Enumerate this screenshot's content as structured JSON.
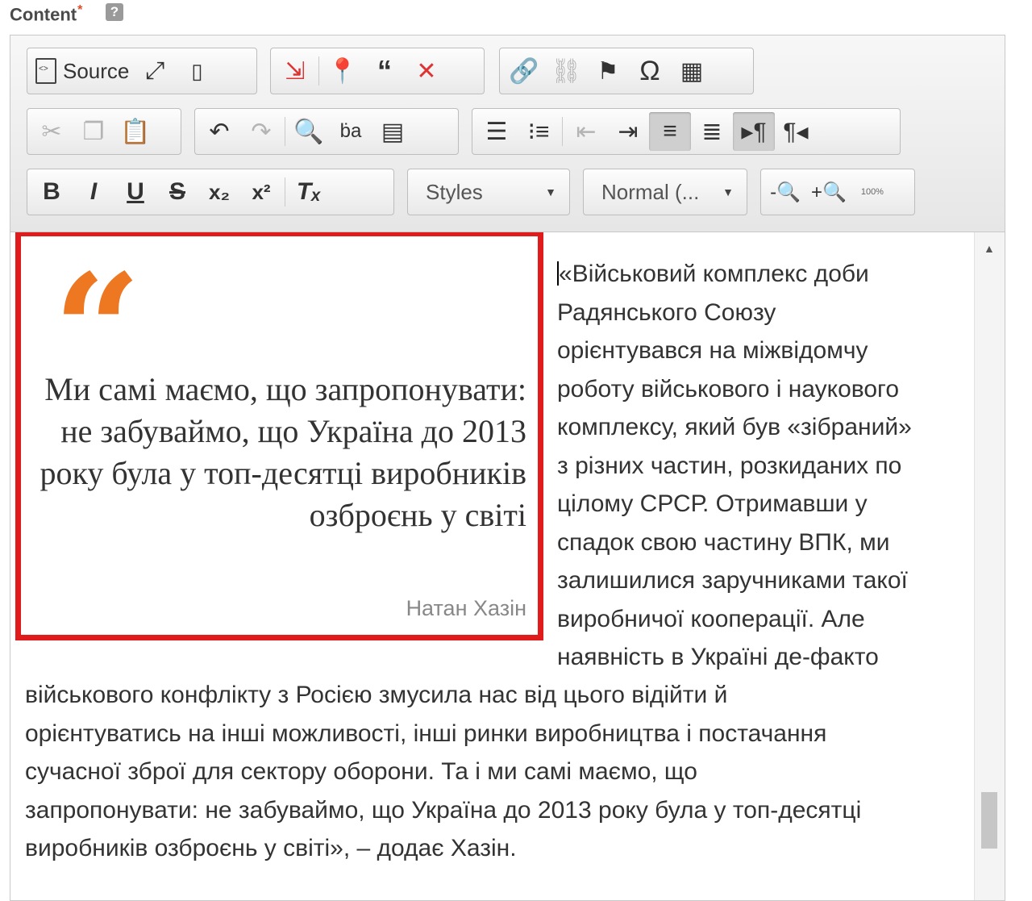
{
  "field": {
    "label": "Content",
    "required_mark": "*",
    "help": "?"
  },
  "toolbar": {
    "source_label": "Source",
    "styles_value": "Styles",
    "format_value": "Normal (...",
    "zoom_label": "100%",
    "icons": {
      "bold": "B",
      "italic": "I",
      "underline": "U",
      "strike": "S",
      "subscript": "x₂",
      "superscript": "x²",
      "remove_format": "Tₓ"
    }
  },
  "content": {
    "quote": {
      "text": "Ми самі маємо, що запропонувати: не забуваймо, що Україна до 2013 року була у топ-десятці виробників озброєнь у світі",
      "author": "Натан Хазін"
    },
    "side_lines": [
      "«Військовий комплекс доби",
      "Радянського Союзу",
      "орієнтувався на міжвідомчу",
      "роботу військового і наукового",
      "комплексу, який був «зібраний»",
      "з різних частин, розкиданих по",
      "цілому СРСР. Отримавши у",
      "спадок свою частину ВПК, ми",
      "залишилися заручниками такої",
      "виробничої кооперації. Але",
      "наявність в Україні де-факто"
    ],
    "full_lines": [
      "військового конфлікту з Росією змусила нас від цього відійти й",
      "орієнтуватись на інші можливості, інші ринки виробництва і постачання",
      "сучасної зброї для сектору оборони. Та і ми самі маємо, що",
      "запропонувати: не забуваймо, що Україна до 2013 року була у топ-десятці",
      "виробників озброєнь у світі», – додає Хазін."
    ]
  },
  "colors": {
    "quote_border": "#e01b1b",
    "quote_mark": "#ee7722"
  }
}
